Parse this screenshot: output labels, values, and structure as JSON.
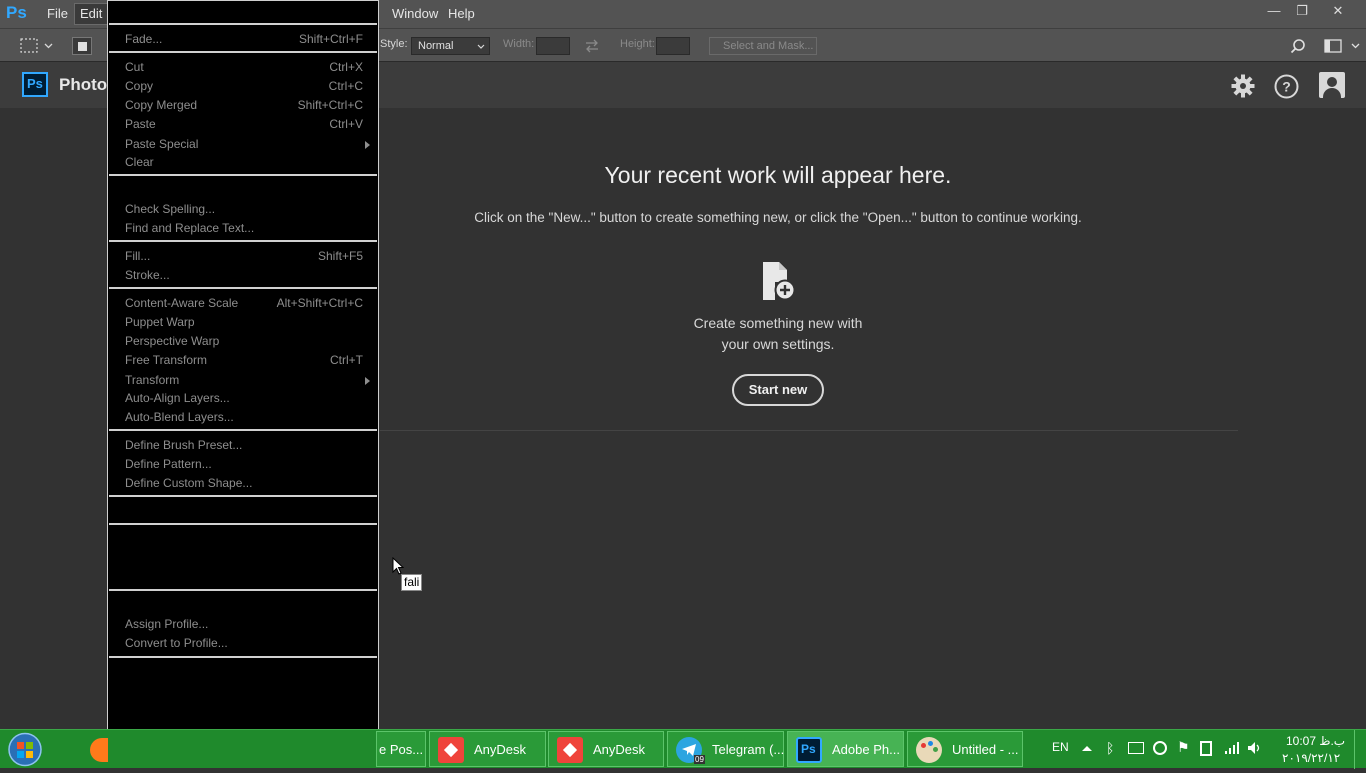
{
  "menubar": {
    "logo": "Ps",
    "items": [
      "File",
      "Edit",
      "Window",
      "Help"
    ],
    "controls": [
      "—",
      "❐",
      "✕"
    ]
  },
  "options": {
    "style_label": "Style:",
    "style_value": "Normal",
    "width_label": "Width:",
    "height_label": "Height:",
    "select_mask": "Select and Mask..."
  },
  "home": {
    "logo": "Ps",
    "title": "Photo"
  },
  "main": {
    "headline": "Your recent work will appear here.",
    "subtext": "Click on the \"New...\" button to create something new, or click the \"Open...\" button to continue working.",
    "create_line1": "Create something new with",
    "create_line2": "your own settings.",
    "start_button": "Start new"
  },
  "tooltip": "fali",
  "edit_menu": {
    "items": [
      {
        "label": "Fade...",
        "shortcut": "Shift+Ctrl+F"
      },
      {
        "label": "Cut",
        "shortcut": "Ctrl+X"
      },
      {
        "label": "Copy",
        "shortcut": "Ctrl+C"
      },
      {
        "label": "Copy Merged",
        "shortcut": "Shift+Ctrl+C"
      },
      {
        "label": "Paste",
        "shortcut": "Ctrl+V"
      },
      {
        "label": "Paste Special",
        "shortcut": ""
      },
      {
        "label": "Clear",
        "shortcut": ""
      },
      {
        "label": "Check Spelling...",
        "shortcut": ""
      },
      {
        "label": "Find and Replace Text...",
        "shortcut": ""
      },
      {
        "label": "Fill...",
        "shortcut": "Shift+F5"
      },
      {
        "label": "Stroke...",
        "shortcut": ""
      },
      {
        "label": "Content-Aware Scale",
        "shortcut": "Alt+Shift+Ctrl+C"
      },
      {
        "label": "Puppet Warp",
        "shortcut": ""
      },
      {
        "label": "Perspective Warp",
        "shortcut": ""
      },
      {
        "label": "Free Transform",
        "shortcut": "Ctrl+T"
      },
      {
        "label": "Transform",
        "shortcut": ""
      },
      {
        "label": "Auto-Align Layers...",
        "shortcut": ""
      },
      {
        "label": "Auto-Blend Layers...",
        "shortcut": ""
      },
      {
        "label": "Define Brush Preset...",
        "shortcut": ""
      },
      {
        "label": "Define Pattern...",
        "shortcut": ""
      },
      {
        "label": "Define Custom Shape...",
        "shortcut": ""
      },
      {
        "label": "Assign Profile...",
        "shortcut": ""
      },
      {
        "label": "Convert to Profile...",
        "shortcut": ""
      }
    ]
  },
  "taskbar": {
    "buttons": [
      {
        "label": "e Pos..."
      },
      {
        "label": "AnyDesk"
      },
      {
        "label": "AnyDesk"
      },
      {
        "label": "Telegram (..."
      },
      {
        "label": "Adobe Ph..."
      },
      {
        "label": "Untitled - ..."
      }
    ],
    "telegram_badge": "09",
    "lang": "EN",
    "time": "10:07 ب.ظ",
    "date": "۲۰۱۹/۲۲/۱۲"
  },
  "colors": {
    "taskbar": "#1f8a2c",
    "menu_bg": "#000000",
    "ps_blue": "#31a8ff",
    "anydesk_red": "#ef443b"
  }
}
